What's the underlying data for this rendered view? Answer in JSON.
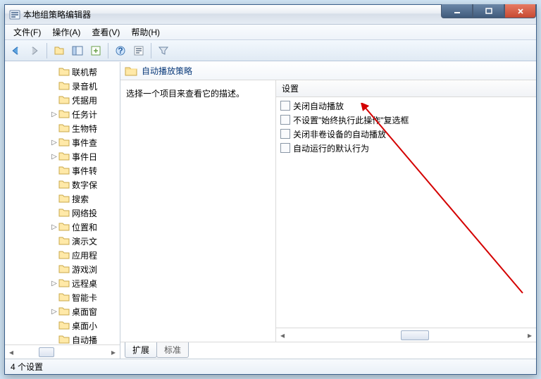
{
  "window": {
    "title": "本地组策略编辑器"
  },
  "menu": {
    "file": "文件(F)",
    "action": "操作(A)",
    "view": "查看(V)",
    "help": "帮助(H)"
  },
  "tree": {
    "items": [
      {
        "label": "联机帮",
        "twisty": ""
      },
      {
        "label": "录音机",
        "twisty": ""
      },
      {
        "label": "凭据用",
        "twisty": ""
      },
      {
        "label": "任务计",
        "twisty": "▷"
      },
      {
        "label": "生物特",
        "twisty": ""
      },
      {
        "label": "事件查",
        "twisty": "▷"
      },
      {
        "label": "事件日",
        "twisty": "▷"
      },
      {
        "label": "事件转",
        "twisty": ""
      },
      {
        "label": "数字保",
        "twisty": ""
      },
      {
        "label": "搜索",
        "twisty": ""
      },
      {
        "label": "网络投",
        "twisty": ""
      },
      {
        "label": "位置和",
        "twisty": "▷"
      },
      {
        "label": "演示文",
        "twisty": ""
      },
      {
        "label": "应用程",
        "twisty": ""
      },
      {
        "label": "游戏浏",
        "twisty": ""
      },
      {
        "label": "远程桌",
        "twisty": "▷"
      },
      {
        "label": "智能卡",
        "twisty": ""
      },
      {
        "label": "桌面窗",
        "twisty": "▷"
      },
      {
        "label": "桌面小",
        "twisty": ""
      },
      {
        "label": "自动播",
        "twisty": ""
      }
    ]
  },
  "detail": {
    "title": "自动播放策略",
    "desc": "选择一个项目来查看它的描述。",
    "column": "设置",
    "rows": [
      "关闭自动播放",
      "不设置\"始终执行此操作\"复选框",
      "关闭非卷设备的自动播放",
      "自动运行的默认行为"
    ],
    "tabs": {
      "extended": "扩展",
      "standard": "标准"
    }
  },
  "status": {
    "text": "4 个设置"
  }
}
